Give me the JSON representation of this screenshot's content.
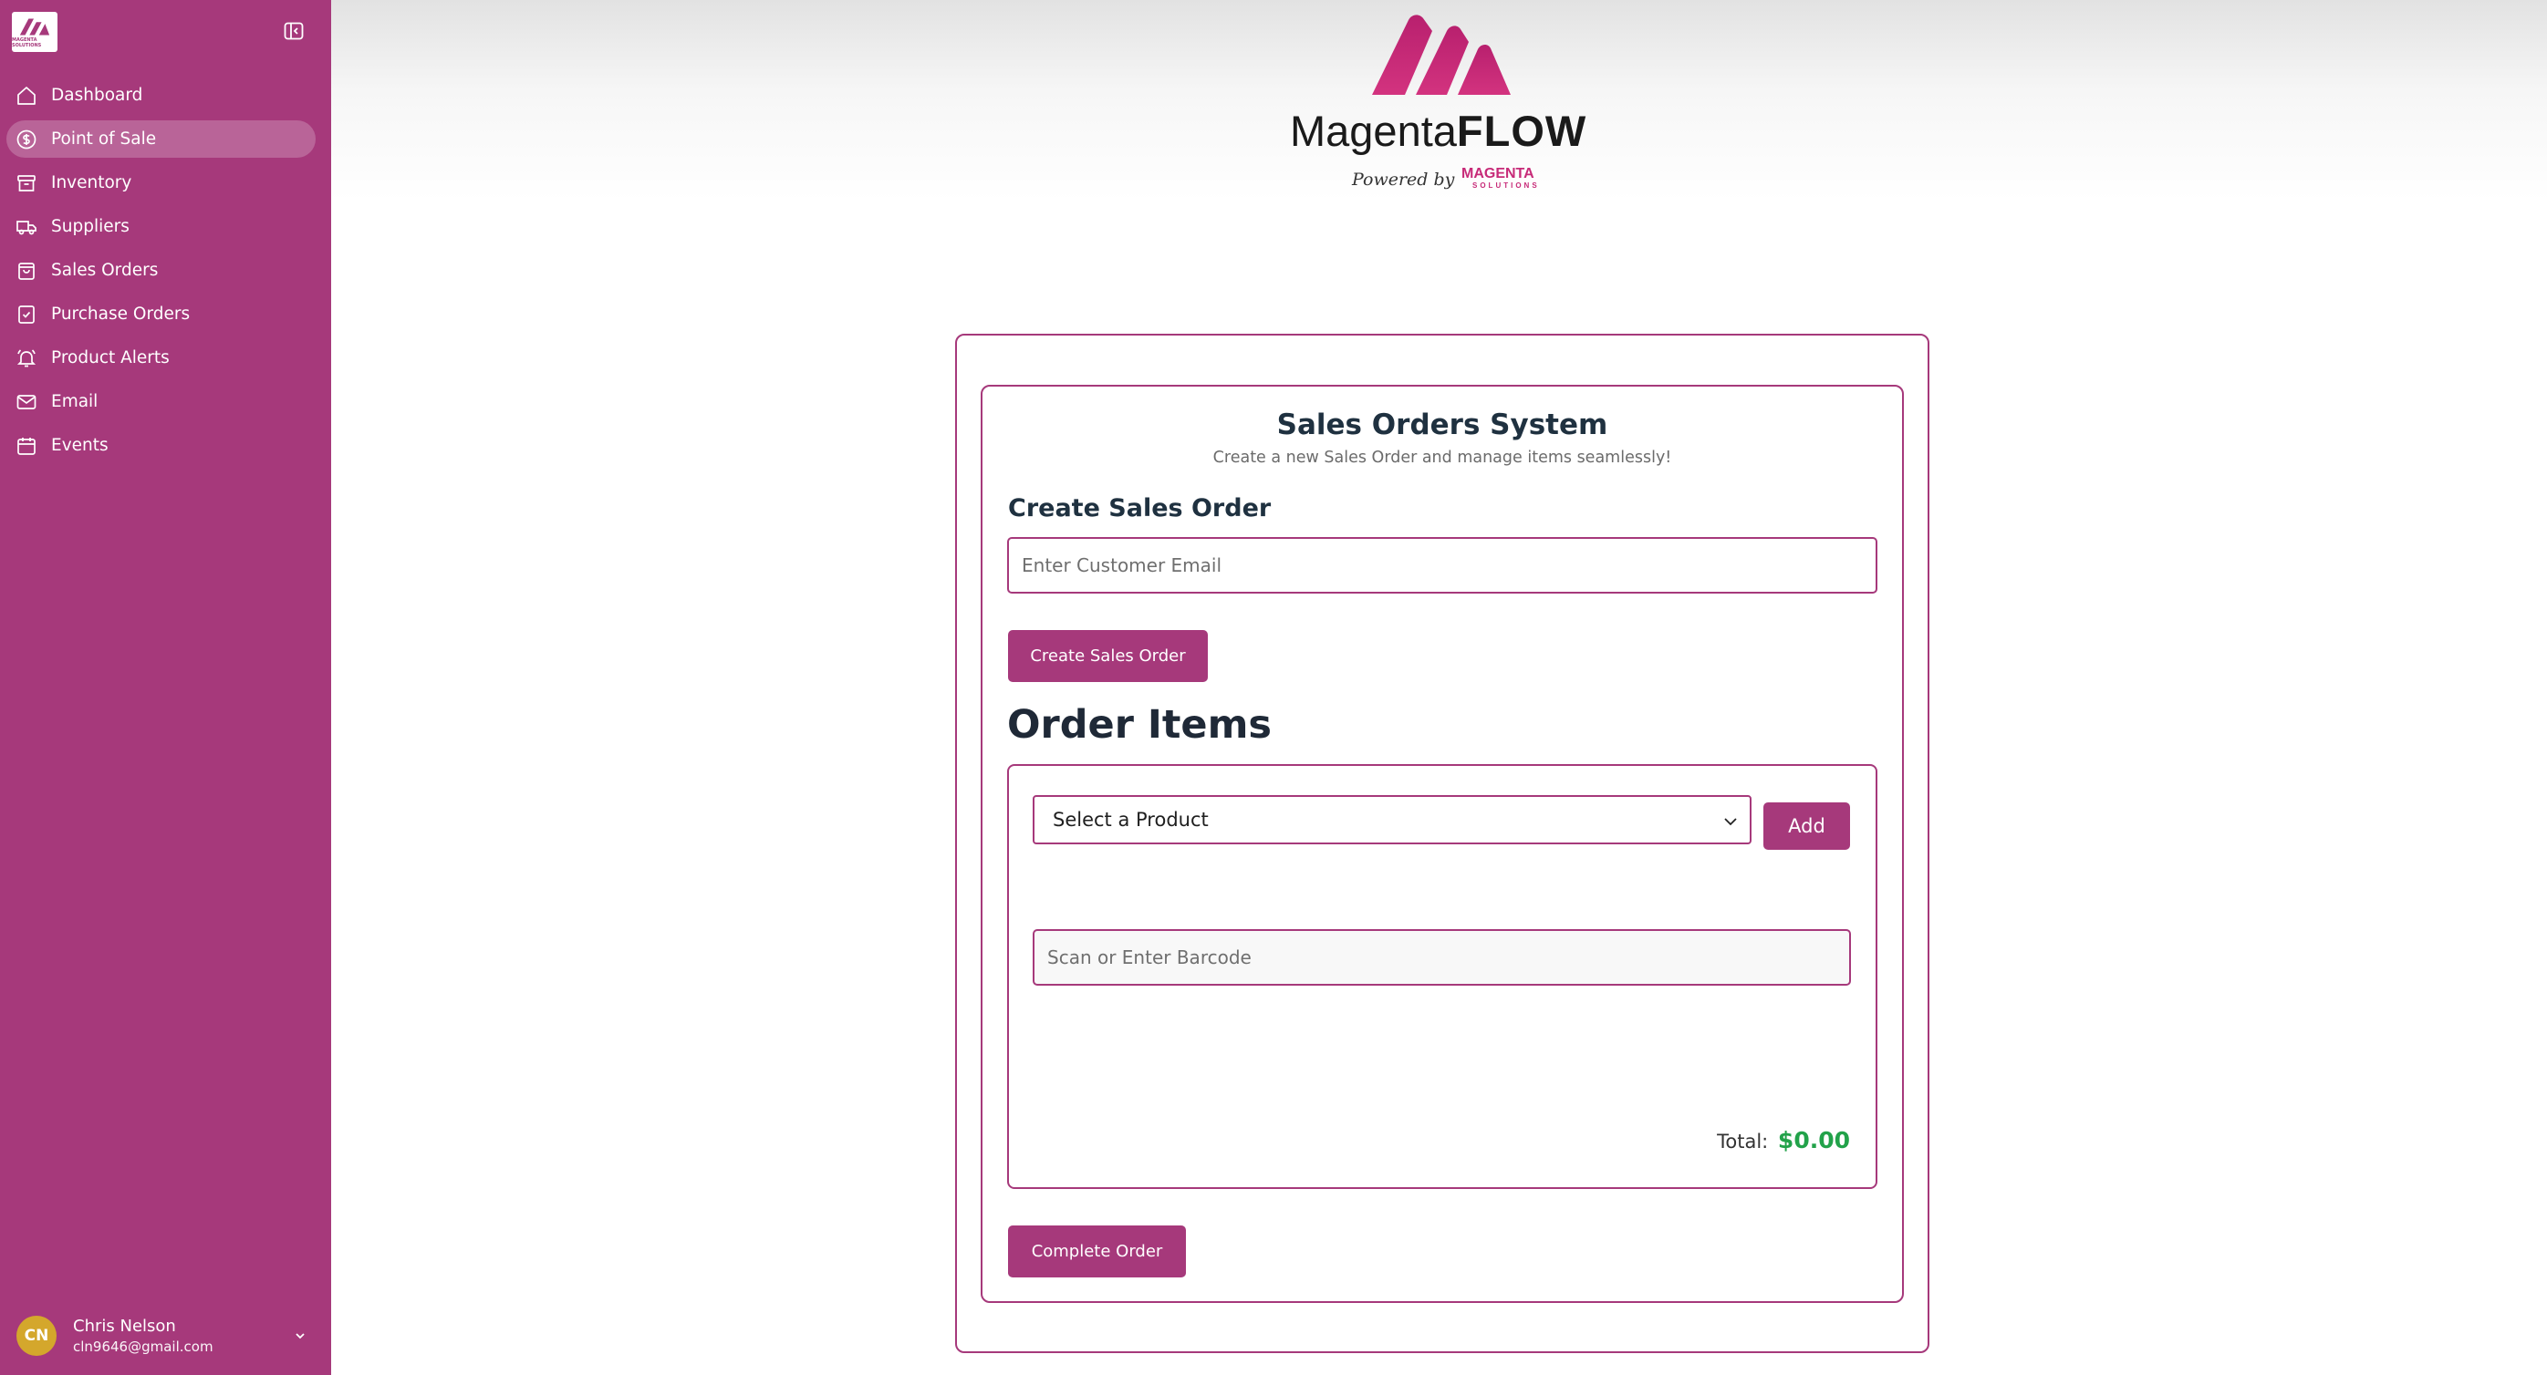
{
  "sidebar": {
    "logo_text": "MAGENTA SOLUTIONS",
    "items": [
      {
        "label": "Dashboard",
        "icon": "home-icon",
        "active": false
      },
      {
        "label": "Point of Sale",
        "icon": "dollar-circle-icon",
        "active": true
      },
      {
        "label": "Inventory",
        "icon": "archive-box-icon",
        "active": false
      },
      {
        "label": "Suppliers",
        "icon": "truck-icon",
        "active": false
      },
      {
        "label": "Sales Orders",
        "icon": "shopping-bag-icon",
        "active": false
      },
      {
        "label": "Purchase Orders",
        "icon": "clipboard-check-icon",
        "active": false
      },
      {
        "label": "Product Alerts",
        "icon": "bell-alert-icon",
        "active": false
      },
      {
        "label": "Email",
        "icon": "envelope-icon",
        "active": false
      },
      {
        "label": "Events",
        "icon": "calendar-icon",
        "active": false
      }
    ],
    "user": {
      "initials": "CN",
      "name": "Chris Nelson",
      "email": "cln9646@gmail.com"
    }
  },
  "brand": {
    "name_light": "Magenta",
    "name_bold": "FLOW",
    "powered_by": "Powered by",
    "company": "MAGENTA",
    "company_sub": "SOLUTIONS"
  },
  "main": {
    "title": "Sales Orders System",
    "subtitle": "Create a new Sales Order and manage items seamlessly!",
    "create_heading": "Create Sales Order",
    "email_placeholder": "Enter Customer Email",
    "create_button": "Create Sales Order",
    "order_items_heading": "Order Items",
    "product_select": "Select a Product",
    "add_button": "Add",
    "barcode_placeholder": "Scan or Enter Barcode",
    "total_label": "Total:",
    "total_value": "$0.00",
    "complete_button": "Complete Order"
  },
  "colors": {
    "brand": "#a6397b",
    "total": "#22a24a"
  }
}
